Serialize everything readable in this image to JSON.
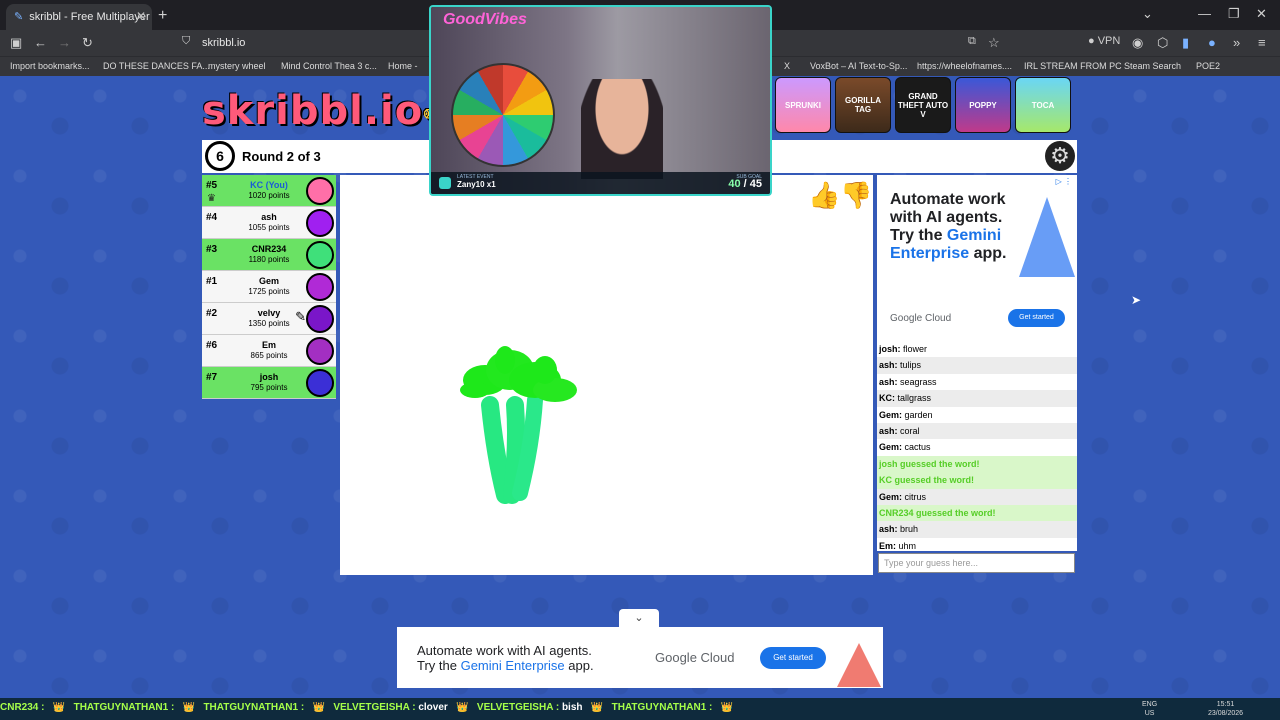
{
  "browser": {
    "tab_title": "skribbl - Free Multiplayer D",
    "url": "skribbl.io",
    "vpn_label": "VPN",
    "bookmarks": [
      "Import bookmarks...",
      "DO THESE DANCES FA...",
      "mystery wheel",
      "Mind Control Thea 3 c...",
      "Home -",
      "X",
      "VoxBot – AI Text-to-Sp...",
      "https://wheelofnames....",
      "IRL STREAM FROM PC",
      "Steam Search",
      "POE2"
    ]
  },
  "game": {
    "logo": "skribbl.io",
    "timer": "6",
    "round": "Round 2 of 3",
    "players": [
      {
        "rank": "#5",
        "name": "KC (You)",
        "points": "1020 points",
        "color": "#ff6fa8"
      },
      {
        "rank": "#4",
        "name": "ash",
        "points": "1055 points",
        "color": "#a020f0"
      },
      {
        "rank": "#3",
        "name": "CNR234",
        "points": "1180 points",
        "color": "#3fe07a"
      },
      {
        "rank": "#1",
        "name": "Gem",
        "points": "1725 points",
        "color": "#b02ad6"
      },
      {
        "rank": "#2",
        "name": "velvy",
        "points": "1350 points",
        "color": "#7a16c9"
      },
      {
        "rank": "#6",
        "name": "Em",
        "points": "865 points",
        "color": "#a32fc2"
      },
      {
        "rank": "#7",
        "name": "josh",
        "points": "795 points",
        "color": "#3b2fd6"
      }
    ],
    "chat": [
      {
        "user": "josh",
        "text": "flower",
        "type": "msg"
      },
      {
        "user": "ash",
        "text": "tulips",
        "type": "msg"
      },
      {
        "user": "ash",
        "text": "seagrass",
        "type": "msg"
      },
      {
        "user": "KC",
        "text": "tallgrass",
        "type": "msg"
      },
      {
        "user": "Gem",
        "text": "garden",
        "type": "msg"
      },
      {
        "user": "ash",
        "text": "coral",
        "type": "msg"
      },
      {
        "user": "Gem",
        "text": "cactus",
        "type": "msg"
      },
      {
        "user": "",
        "text": "josh guessed the word!",
        "type": "guess"
      },
      {
        "user": "",
        "text": "KC guessed the word!",
        "type": "guess"
      },
      {
        "user": "Gem",
        "text": "citrus",
        "type": "msg"
      },
      {
        "user": "",
        "text": "CNR234 guessed the word!",
        "type": "guess"
      },
      {
        "user": "ash",
        "text": "bruh",
        "type": "msg"
      },
      {
        "user": "Em",
        "text": "uhm",
        "type": "msg"
      }
    ],
    "chat_placeholder": "Type your guess here..."
  },
  "ad_right": {
    "line1": "Automate work with AI agents. Try the ",
    "highlight": "Gemini Enterprise",
    "line2": " app.",
    "brand": "Google Cloud",
    "button": "Get started"
  },
  "ad_bottom": {
    "line1": "Automate work with AI agents.",
    "line2a": "Try the ",
    "highlight": "Gemini Enterprise",
    "line2b": " app.",
    "brand": "Google Cloud",
    "button": "Get started"
  },
  "stream": {
    "neon": "GoodVibes",
    "event_label": "LATEST EVENT",
    "event": "Zany10 x1",
    "sub_label": "SUB GOAL",
    "sub_current": "40",
    "sub_total": "/ 45"
  },
  "games": [
    "SPRUNKI",
    "GORILLA TAG",
    "GRAND THEFT AUTO V",
    "POPPY",
    "TOCA"
  ],
  "taskbar": {
    "ticker": [
      {
        "user": "CNR234 :",
        "text": ""
      },
      {
        "user": "THATGUYNATHAN1 :",
        "text": ""
      },
      {
        "user": "THATGUYNATHAN1 :",
        "text": ""
      },
      {
        "user": "VELVETGEISHA :",
        "text": "clover"
      },
      {
        "user": "VELVETGEISHA :",
        "text": "bish"
      },
      {
        "user": "THATGUYNATHAN1 :",
        "text": ""
      }
    ],
    "lang": "ENG",
    "region": "US",
    "time": "15:51",
    "date": "23/08/2026"
  }
}
